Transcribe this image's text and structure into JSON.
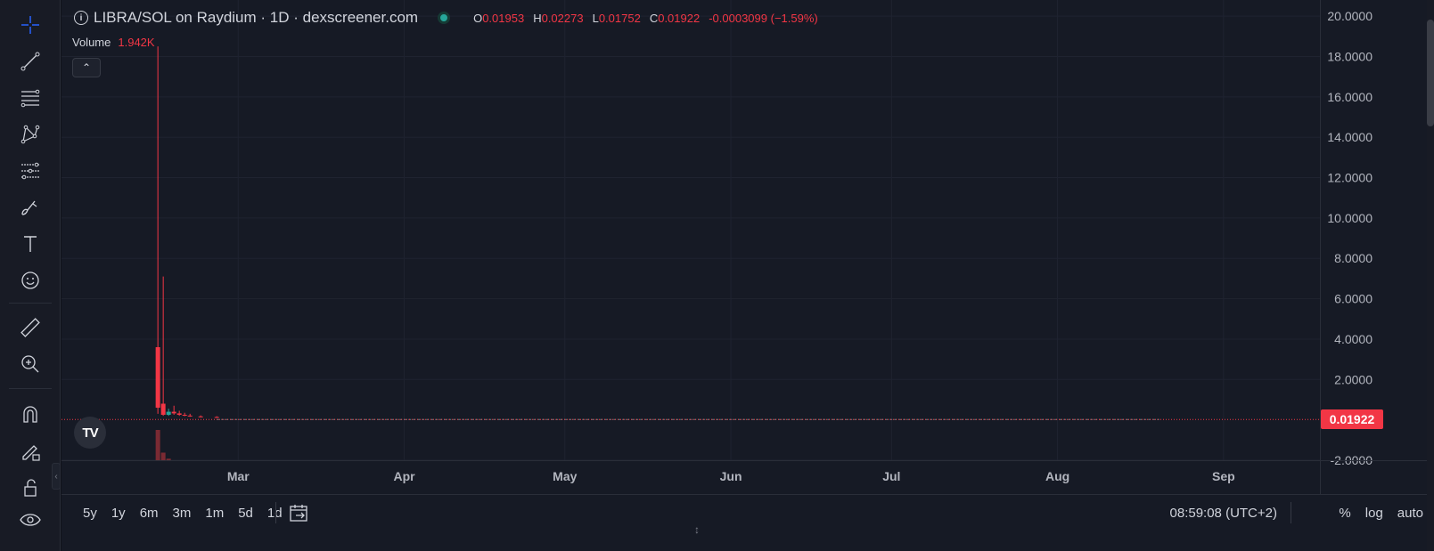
{
  "legend": {
    "title": "LIBRA/SOL on Raydium · 1D · dexscreener.com",
    "o_label": "O",
    "o_value": "0.01953",
    "h_label": "H",
    "h_value": "0.02273",
    "l_label": "L",
    "l_value": "0.01752",
    "c_label": "C",
    "c_value": "0.01922",
    "change": "-0.0003099 (−1.59%)"
  },
  "volume": {
    "label": "Volume",
    "value": "1.942K"
  },
  "collapse_icon": "chevron-up-icon",
  "tv_logo_text": "TV",
  "price_badge": "0.01922",
  "ranges": [
    "5y",
    "1y",
    "6m",
    "3m",
    "1m",
    "5d",
    "1d"
  ],
  "clock": "08:59:08 (UTC+2)",
  "options": {
    "percent": "%",
    "log": "log",
    "auto": "auto"
  },
  "colors": {
    "down": "#f23645",
    "up": "#26a69a",
    "grid": "#1f2330",
    "axis_text": "#b2b5be"
  },
  "chart_data": {
    "type": "candlestick",
    "title": "LIBRA/SOL on Raydium · 1D · dexscreener.com",
    "y_ticks": [
      "20.0000",
      "18.0000",
      "16.0000",
      "14.0000",
      "12.0000",
      "10.0000",
      "8.0000",
      "6.0000",
      "4.0000",
      "2.0000",
      "-2.0000"
    ],
    "y_tick_values": [
      20,
      18,
      16,
      14,
      12,
      10,
      8,
      6,
      4,
      2,
      -2
    ],
    "ylim": [
      -2,
      20.8
    ],
    "x_ticks": [
      "Mar",
      "Apr",
      "May",
      "Jun",
      "Jul",
      "Aug",
      "Sep"
    ],
    "x_tick_dates": [
      "2025-03-01",
      "2025-04-01",
      "2025-05-01",
      "2025-06-01",
      "2025-07-01",
      "2025-08-01",
      "2025-09-01"
    ],
    "xlim": [
      "2025-01-27",
      "2025-09-19"
    ],
    "last_price": 0.01922,
    "candles": [
      {
        "date": "2025-02-14",
        "open": 3.6,
        "high": 18.5,
        "low": 0.3,
        "close": 0.6,
        "dir": "down"
      },
      {
        "date": "2025-02-15",
        "open": 0.8,
        "high": 7.1,
        "low": 0.2,
        "close": 0.25,
        "dir": "down"
      },
      {
        "date": "2025-02-16",
        "open": 0.25,
        "high": 0.55,
        "low": 0.2,
        "close": 0.4,
        "dir": "up"
      },
      {
        "date": "2025-02-17",
        "open": 0.4,
        "high": 0.7,
        "low": 0.25,
        "close": 0.32,
        "dir": "down"
      },
      {
        "date": "2025-02-18",
        "open": 0.32,
        "high": 0.45,
        "low": 0.2,
        "close": 0.25,
        "dir": "down"
      },
      {
        "date": "2025-02-19",
        "open": 0.25,
        "high": 0.35,
        "low": 0.18,
        "close": 0.21,
        "dir": "down"
      },
      {
        "date": "2025-02-20",
        "open": 0.21,
        "high": 0.3,
        "low": 0.15,
        "close": 0.17,
        "dir": "down"
      },
      {
        "date": "2025-02-22",
        "open": 0.17,
        "high": 0.22,
        "low": 0.12,
        "close": 0.14,
        "dir": "down"
      },
      {
        "date": "2025-02-25",
        "open": 0.14,
        "high": 0.18,
        "low": 0.09,
        "close": 0.1,
        "dir": "down"
      }
    ],
    "tail_start": "2025-02-25",
    "tail_end": "2025-08-20",
    "tail_value": 0.02,
    "volume_bars": [
      {
        "date": "2025-02-14",
        "value": 1.0
      },
      {
        "date": "2025-02-15",
        "value": 0.25
      },
      {
        "date": "2025-02-16",
        "value": 0.05
      }
    ]
  }
}
